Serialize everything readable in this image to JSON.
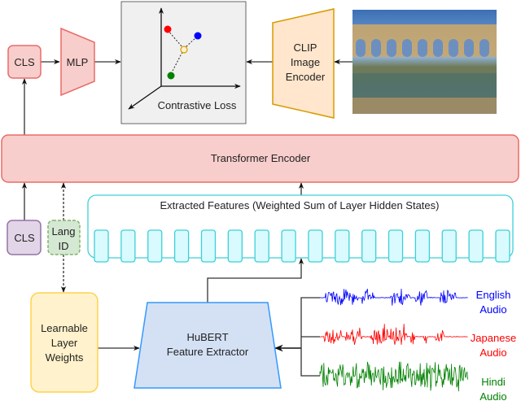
{
  "nodes": {
    "cls_top": "CLS",
    "mlp": "MLP",
    "contrastive_loss": "Contrastive Loss",
    "clip_line1": "CLIP",
    "clip_line2": "Image",
    "clip_line3": "Encoder",
    "transformer": "Transformer Encoder",
    "cls_bottom": "CLS",
    "lang_id_line1": "Lang",
    "lang_id_line2": "ID",
    "extracted_features": "Extracted Features (Weighted Sum of Layer Hidden States)",
    "learnable_line1": "Learnable",
    "learnable_line2": "Layer",
    "learnable_line3": "Weights",
    "hubert_line1": "HuBERT",
    "hubert_line2": "Feature Extractor"
  },
  "audio": [
    {
      "line1": "English",
      "line2": "Audio",
      "color": "#0000ff"
    },
    {
      "line1": "Japanese",
      "line2": "Audio",
      "color": "#ff0000"
    },
    {
      "line1": "Hindi",
      "line2": "Audio",
      "color": "#008000"
    }
  ],
  "feature_token_count": 16,
  "colors": {
    "pink_fill": "#f8cecc",
    "pink_stroke": "#ea6b66",
    "clip_fill": "#ffe6cc",
    "clip_stroke": "#d79b00",
    "purple_fill": "#e1d5e7",
    "purple_stroke": "#9673a6",
    "green_fill": "#d5e8d4",
    "green_stroke": "#82b366",
    "cyan_fill": "#d9fbff",
    "cyan_stroke": "#3cd0d8",
    "yellow_fill": "#fff2cc",
    "yellow_stroke": "#ffd34d",
    "blue_fill": "#d4e1f5",
    "blue_stroke": "#3399ff"
  }
}
